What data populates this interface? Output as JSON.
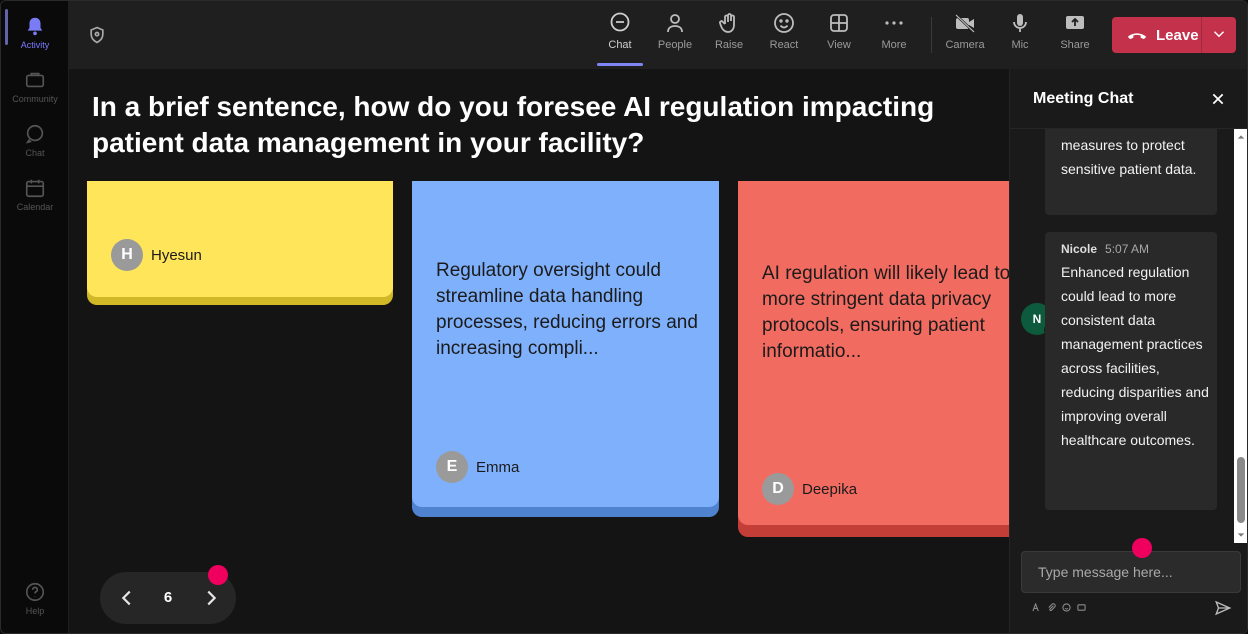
{
  "rail": {
    "items": [
      {
        "label": "Activity",
        "icon": "bell-icon"
      },
      {
        "label": "Community",
        "icon": "community-icon"
      },
      {
        "label": "Chat",
        "icon": "chat-icon"
      },
      {
        "label": "Calendar",
        "icon": "calendar-icon"
      },
      {
        "label": "Help",
        "icon": "help-icon"
      }
    ]
  },
  "toolbar": {
    "chat": "Chat",
    "people": "People",
    "raise": "Raise",
    "react": "React",
    "view": "View",
    "more": "More",
    "camera": "Camera",
    "mic": "Mic",
    "share": "Share",
    "leave": "Leave"
  },
  "stage": {
    "question": "In a brief sentence, how do you foresee AI regulation impacting patient data management in your facility?",
    "cards": [
      {
        "text": "",
        "author": "Hyesun",
        "initial": "H",
        "color": "#ffe55a",
        "shadow": "#d0b826"
      },
      {
        "text": "Regulatory oversight could streamline data handling processes, reducing errors and increasing compli...",
        "author": "Emma",
        "initial": "E",
        "color": "#7fb0fb",
        "shadow": "#4f82cf"
      },
      {
        "text": "AI regulation will likely lead to more stringent data privacy protocols, ensuring patient informatio...",
        "author": "Deepika",
        "initial": "D",
        "color": "#f26b60",
        "shadow": "#c23e36"
      }
    ],
    "page": "6"
  },
  "chat": {
    "title": "Meeting Chat",
    "messages": [
      {
        "text": "measures to protect sensitive patient data."
      },
      {
        "sender": "Nicole",
        "initial": "N",
        "time": "5:07 AM",
        "text": "Enhanced regulation could lead to more consistent data management practices across facilities, reducing disparities and improving overall healthcare outcomes."
      }
    ],
    "placeholder": "Type message here..."
  }
}
